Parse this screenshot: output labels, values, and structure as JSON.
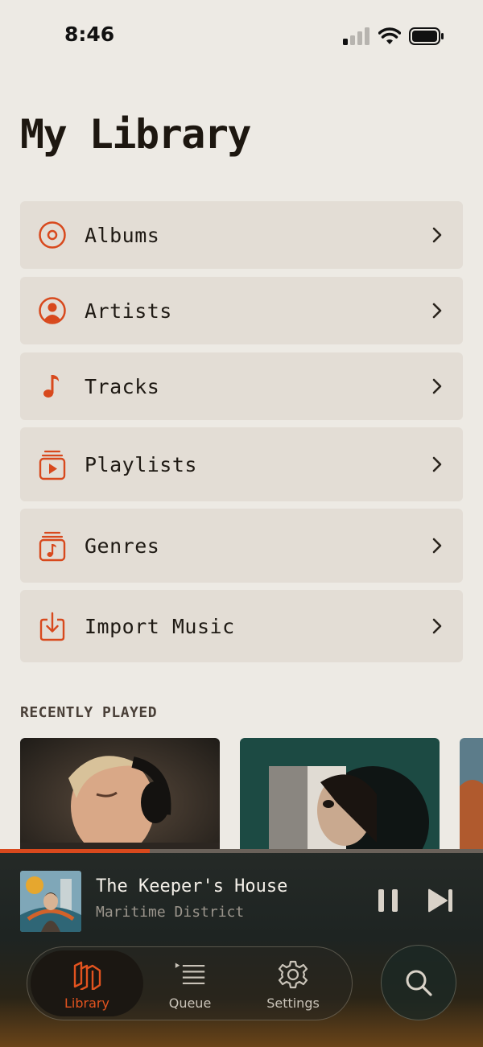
{
  "status_bar": {
    "time": "8:46",
    "icons": [
      "cellular-signal-icon",
      "wifi-icon",
      "battery-icon"
    ]
  },
  "page": {
    "title": "My Library"
  },
  "menu": {
    "accent_color": "#d8491d",
    "items": [
      {
        "label": "Albums",
        "icon": "album-disc-icon"
      },
      {
        "label": "Artists",
        "icon": "artist-person-icon"
      },
      {
        "label": "Tracks",
        "icon": "music-note-icon"
      },
      {
        "label": "Playlists",
        "icon": "playlist-icon"
      },
      {
        "label": "Genres",
        "icon": "genres-icon"
      },
      {
        "label": "Import Music",
        "icon": "import-download-icon"
      }
    ]
  },
  "recently_played": {
    "header": "RECENTLY PLAYED",
    "cards": [
      "recent-album-art",
      "recent-album-art",
      "recent-album-art"
    ]
  },
  "now_playing": {
    "title": "The Keeper's House",
    "artist": "Maritime District",
    "progress": 0.31,
    "controls": [
      "pause-icon",
      "next-track-icon"
    ]
  },
  "tabbar": {
    "tabs": [
      {
        "label": "Library",
        "icon": "library-icon",
        "active": true
      },
      {
        "label": "Queue",
        "icon": "queue-list-icon",
        "active": false
      },
      {
        "label": "Settings",
        "icon": "gear-icon",
        "active": false
      }
    ],
    "search_icon": "search-icon"
  }
}
